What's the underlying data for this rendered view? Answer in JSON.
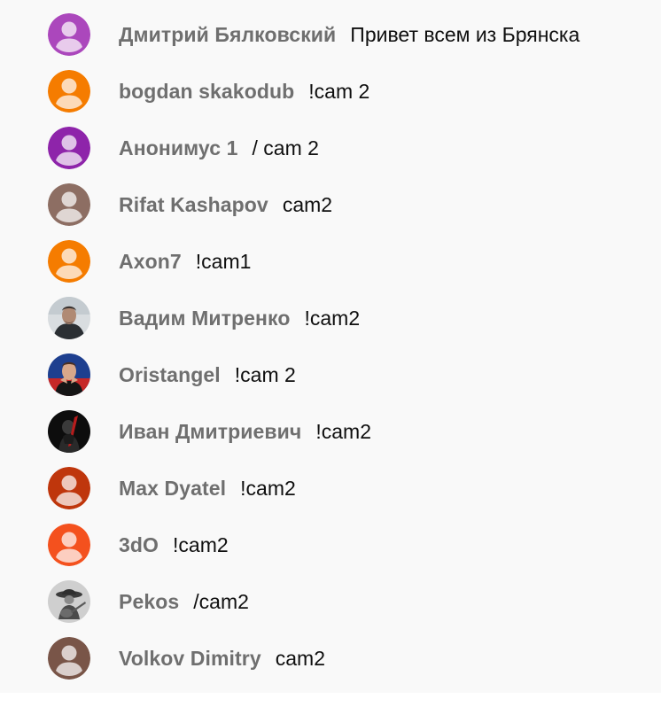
{
  "chat": {
    "messages": [
      {
        "author": "Дмитрий Бялковский",
        "text": "Привет всем из Брянска",
        "avatar": {
          "kind": "default",
          "color": "#ab47bc"
        }
      },
      {
        "author": "bogdan skakodub",
        "text": "!cam 2",
        "avatar": {
          "kind": "default",
          "color": "#f57c00"
        }
      },
      {
        "author": "Анонимус 1",
        "text": "/ cam 2",
        "avatar": {
          "kind": "default",
          "color": "#8e24aa"
        }
      },
      {
        "author": "Rifat Kashapov",
        "text": "cam2",
        "avatar": {
          "kind": "default",
          "color": "#8d6e63"
        }
      },
      {
        "author": "Axon7",
        "text": "!cam1",
        "avatar": {
          "kind": "default",
          "color": "#f57c00"
        }
      },
      {
        "author": "Вадим Митренко",
        "text": "!cam2",
        "avatar": {
          "kind": "photo",
          "icon": "man-in-hoodie-photo"
        }
      },
      {
        "author": "Oristangel",
        "text": "!cam 2",
        "avatar": {
          "kind": "photo",
          "icon": "man-in-suit-photo"
        }
      },
      {
        "author": "Иван Дмитриевич",
        "text": "!cam2",
        "avatar": {
          "kind": "photo",
          "icon": "dark-figure-photo"
        }
      },
      {
        "author": "Max Dyatel",
        "text": "!cam2",
        "avatar": {
          "kind": "default",
          "color": "#bf360c"
        }
      },
      {
        "author": "3dO",
        "text": "!cam2",
        "avatar": {
          "kind": "default",
          "color": "#f4511e"
        }
      },
      {
        "author": "Pekos",
        "text": "/cam2",
        "avatar": {
          "kind": "photo",
          "icon": "cowboy-guitar-photo"
        }
      },
      {
        "author": "Volkov Dimitry",
        "text": "cam2",
        "avatar": {
          "kind": "default",
          "color": "#795548"
        }
      }
    ]
  },
  "colors": {
    "panel_background": "#f9f9f9",
    "author_text": "#6f6f6f",
    "message_text": "#0f0f0f"
  }
}
